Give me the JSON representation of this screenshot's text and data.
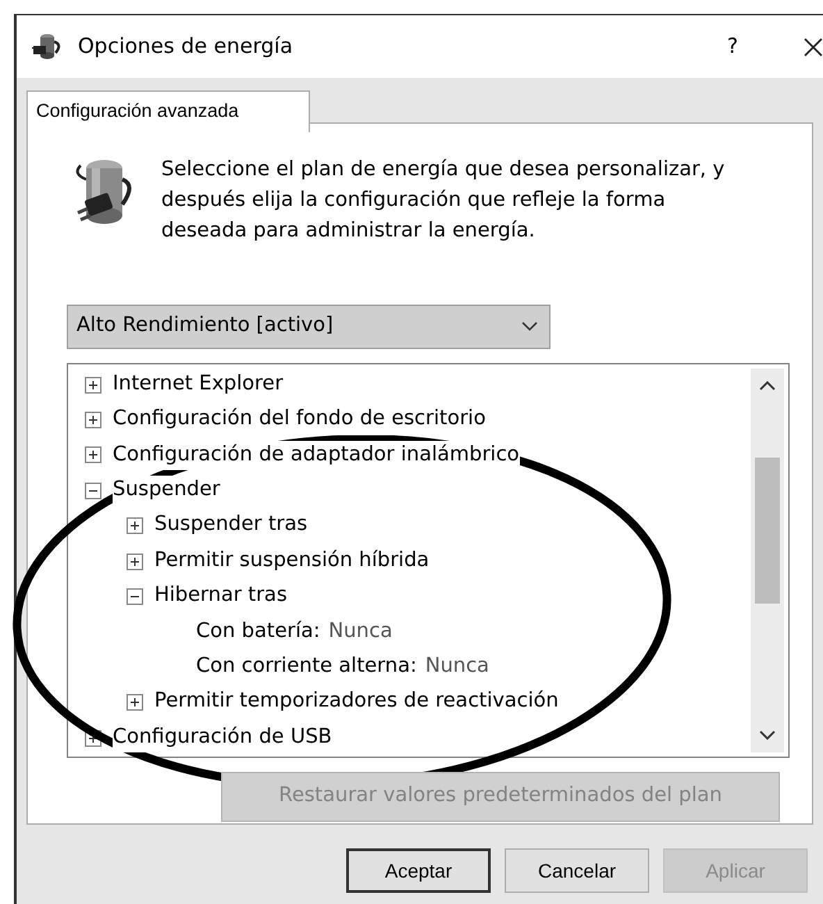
{
  "window": {
    "title": "Opciones de energía",
    "help_button": "?"
  },
  "tabs": [
    {
      "label": "Configuración avanzada",
      "selected": true
    }
  ],
  "description": "Seleccione el plan de energía que desea personalizar, y después elija la configuración que refleje la forma deseada para administrar la energía.",
  "plan_dropdown": {
    "value": "Alto Rendimiento [activo]"
  },
  "settings_tree": [
    {
      "kind": "group",
      "label": "Internet Explorer",
      "expanded": false
    },
    {
      "kind": "group",
      "label": "Configuración del fondo de escritorio",
      "expanded": false
    },
    {
      "kind": "group",
      "label": "Configuración de adaptador inalámbrico",
      "expanded": false
    },
    {
      "kind": "group",
      "label": "Suspender",
      "expanded": true,
      "children": [
        {
          "kind": "group",
          "label": "Suspender tras",
          "expanded": false
        },
        {
          "kind": "group",
          "label": "Permitir suspensión híbrida",
          "expanded": false
        },
        {
          "kind": "group",
          "label": "Hibernar tras",
          "expanded": true,
          "children": [
            {
              "kind": "setting",
              "label": "Con batería:",
              "value": "Nunca"
            },
            {
              "kind": "setting",
              "label": "Con corriente alterna:",
              "value": "Nunca"
            }
          ]
        },
        {
          "kind": "group",
          "label": "Permitir temporizadores de reactivación",
          "expanded": false
        }
      ]
    },
    {
      "kind": "group",
      "label": "Configuración de USB",
      "expanded": false
    }
  ],
  "restore_button": {
    "label": "Restaurar valores predeterminados del plan",
    "disabled": true
  },
  "buttons": [
    {
      "label": "Aceptar",
      "default": true,
      "disabled": false
    },
    {
      "label": "Cancelar",
      "default": false,
      "disabled": false
    },
    {
      "label": "Aplicar",
      "default": false,
      "disabled": true
    }
  ]
}
